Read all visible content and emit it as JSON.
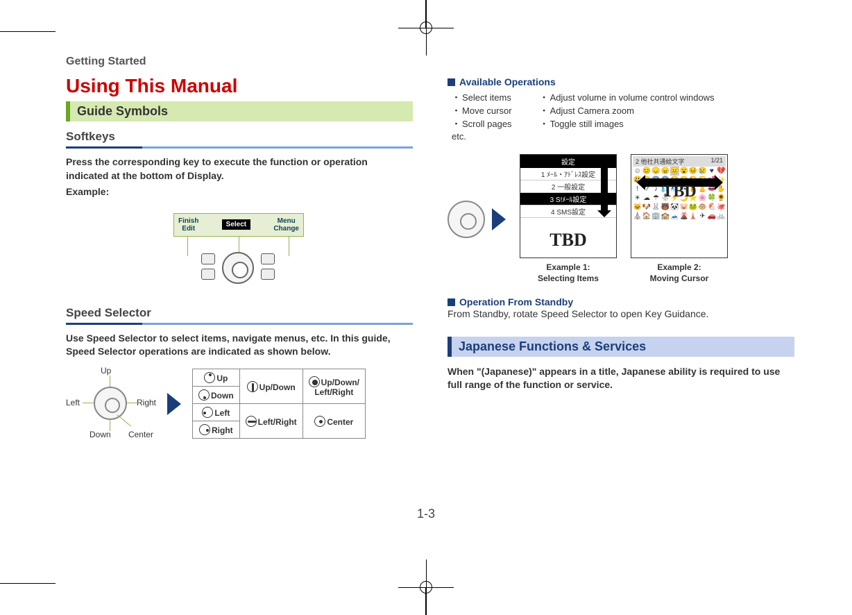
{
  "breadcrumb": "Getting Started",
  "section_title": "Using This Manual",
  "guide_symbols_header": "Guide Symbols",
  "softkeys": {
    "heading": "Softkeys",
    "lead": "Press the corresponding key to execute the function or operation indicated at the bottom of Display.",
    "example_label": "Example:",
    "bar_left_top": "Finish",
    "bar_left_bottom": "Edit",
    "bar_center": "Select",
    "bar_right_top": "Menu",
    "bar_right_bottom": "Change"
  },
  "speed_selector": {
    "heading": "Speed Selector",
    "lead": "Use Speed Selector to select items, navigate menus, etc. In this guide, Speed Selector operations are indicated as shown below.",
    "labels": {
      "up": "Up",
      "down": "Down",
      "left": "Left",
      "right": "Right",
      "center": "Center"
    },
    "table": {
      "up": "Up",
      "down": "Down",
      "updown": "Up/Down",
      "left": "Left",
      "right": "Right",
      "leftright": "Left/Right",
      "center": "Center",
      "all": "Up/Down/\nLeft/Right"
    }
  },
  "available_ops": {
    "heading": "Available Operations",
    "col1": [
      "Select items",
      "Move cursor",
      "Scroll pages"
    ],
    "col2": [
      "Adjust volume in volume control windows",
      "Adjust Camera zoom",
      "Toggle still images"
    ],
    "etc": "etc."
  },
  "examples": {
    "screen1_title": "設定",
    "screen1_rows": [
      "1 ﾒｰﾙ・ｱﾄﾞﾚｽ設定",
      "2 一般設定",
      "3 S!ﾒｰﾙ設定",
      "4 SMS設定"
    ],
    "tbd": "TBD",
    "screen2_header_left": "2 他社共通絵文字",
    "screen2_header_right": "1/21",
    "caption1_line1": "Example 1:",
    "caption1_line2": "Selecting Items",
    "caption2_line1": "Example 2:",
    "caption2_line2": "Moving Cursor"
  },
  "operation_standby": {
    "heading": "Operation From Standby",
    "body": "From Standby, rotate Speed Selector to open Key Guidance."
  },
  "jp_header": "Japanese Functions & Services",
  "jp_body": "When \"(Japanese)\" appears in a title, Japanese ability is required to use full range of the function or service.",
  "page_number": "1-3"
}
